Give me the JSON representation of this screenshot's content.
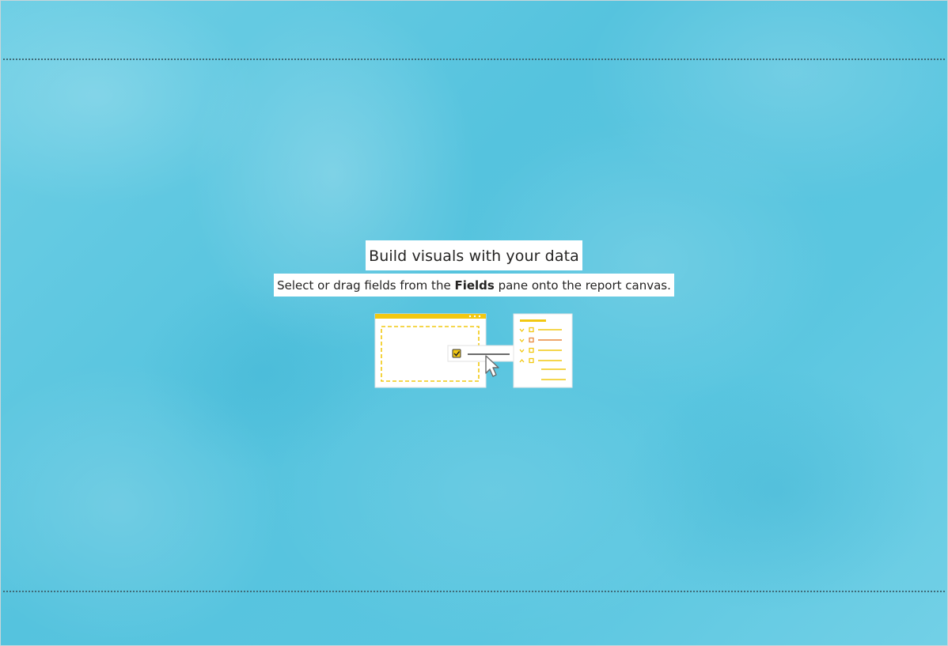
{
  "empty_state": {
    "title": "Build visuals with your data",
    "subtitle_before": "Select or drag fields from the ",
    "subtitle_bold": "Fields",
    "subtitle_after": " pane onto the report canvas."
  },
  "illustration": {
    "icons": [
      "report-canvas-icon",
      "checkbox-icon",
      "cursor-icon",
      "fields-pane-icon"
    ],
    "accent_color": "#f2c811",
    "secondary_color": "#e8893b"
  },
  "colors": {
    "canvas_background": "#5ac6e0",
    "text": "#252423",
    "guide_line": "#3f6b78"
  }
}
